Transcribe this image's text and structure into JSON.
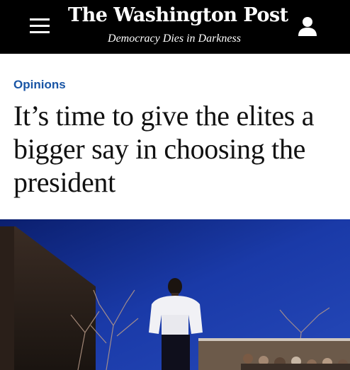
{
  "header": {
    "logo_text": "The Washington Post",
    "tagline": "Democracy Dies in Darkness",
    "menu_icon": "hamburger-menu-icon",
    "account_icon": "user-account-icon",
    "background_color": "#000000"
  },
  "article": {
    "section_label": "Opinions",
    "section_color": "#1955a5",
    "headline": "It’s time to give the elites a bigger say in choosing the president"
  },
  "hero_image": {
    "description_icon": "photo-image"
  }
}
